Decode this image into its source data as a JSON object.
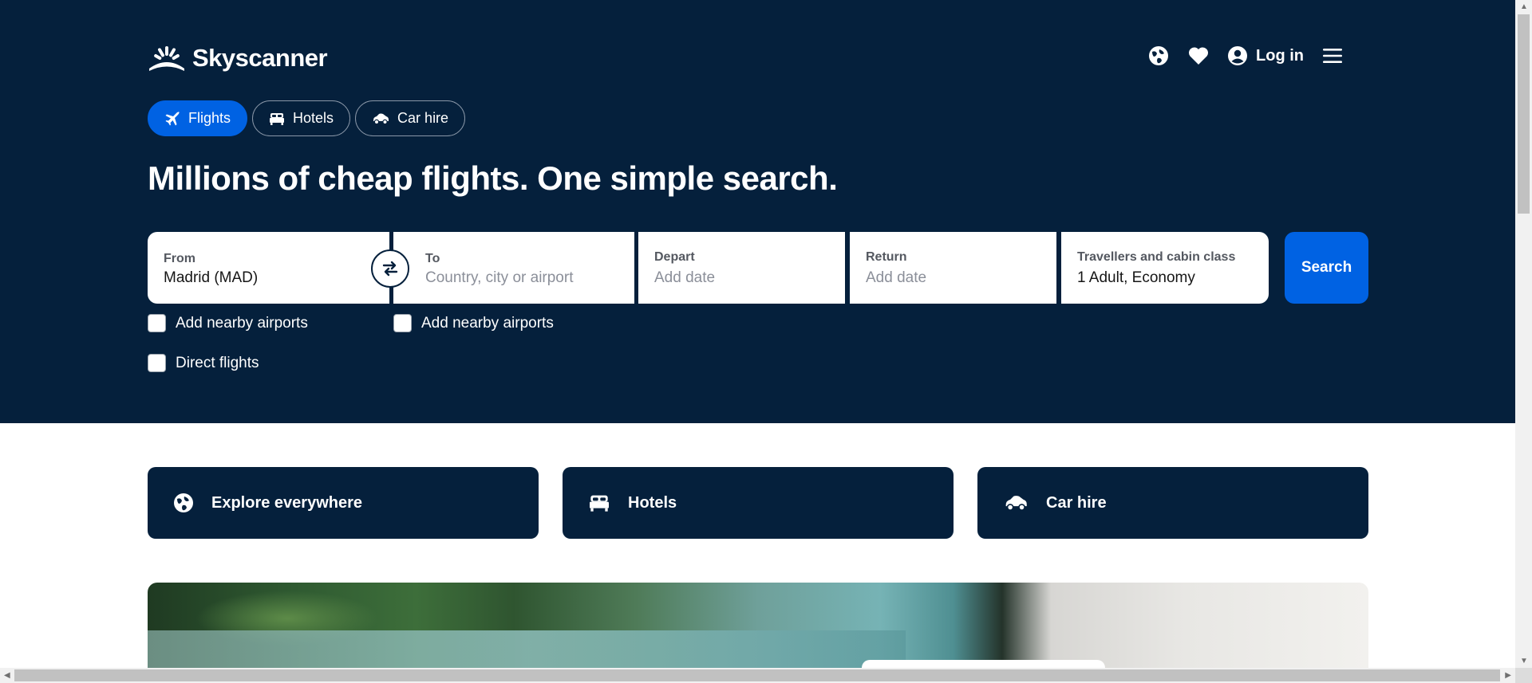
{
  "brand": {
    "name": "Skyscanner",
    "logo_icon": "sunrise-logo-icon"
  },
  "header": {
    "region_icon": "globe-icon",
    "favourites_icon": "heart-icon",
    "account_icon": "user-circle-icon",
    "login_label": "Log in",
    "menu_icon": "hamburger-menu-icon"
  },
  "tabs": [
    {
      "label": "Flights",
      "icon": "plane-icon",
      "active": true
    },
    {
      "label": "Hotels",
      "icon": "bed-icon",
      "active": false
    },
    {
      "label": "Car hire",
      "icon": "car-icon",
      "active": false
    }
  ],
  "headline": "Millions of cheap flights. One simple search.",
  "search": {
    "from": {
      "label": "From",
      "value": "Madrid (MAD)"
    },
    "to": {
      "label": "To",
      "placeholder": "Country, city or airport"
    },
    "depart": {
      "label": "Depart",
      "placeholder": "Add date"
    },
    "return": {
      "label": "Return",
      "placeholder": "Add date"
    },
    "travellers": {
      "label": "Travellers and cabin class",
      "value": "1 Adult, Economy"
    },
    "swap_icon": "swap-arrows-icon",
    "search_label": "Search"
  },
  "options": {
    "from_nearby": "Add nearby airports",
    "to_nearby": "Add nearby airports",
    "direct": "Direct flights"
  },
  "quick_links": [
    {
      "label": "Explore everywhere",
      "icon": "globe-icon"
    },
    {
      "label": "Hotels",
      "icon": "bed-icon"
    },
    {
      "label": "Car hire",
      "icon": "car-icon"
    }
  ],
  "colors": {
    "hero_bg": "#05203c",
    "accent": "#0062e3",
    "white": "#ffffff"
  }
}
